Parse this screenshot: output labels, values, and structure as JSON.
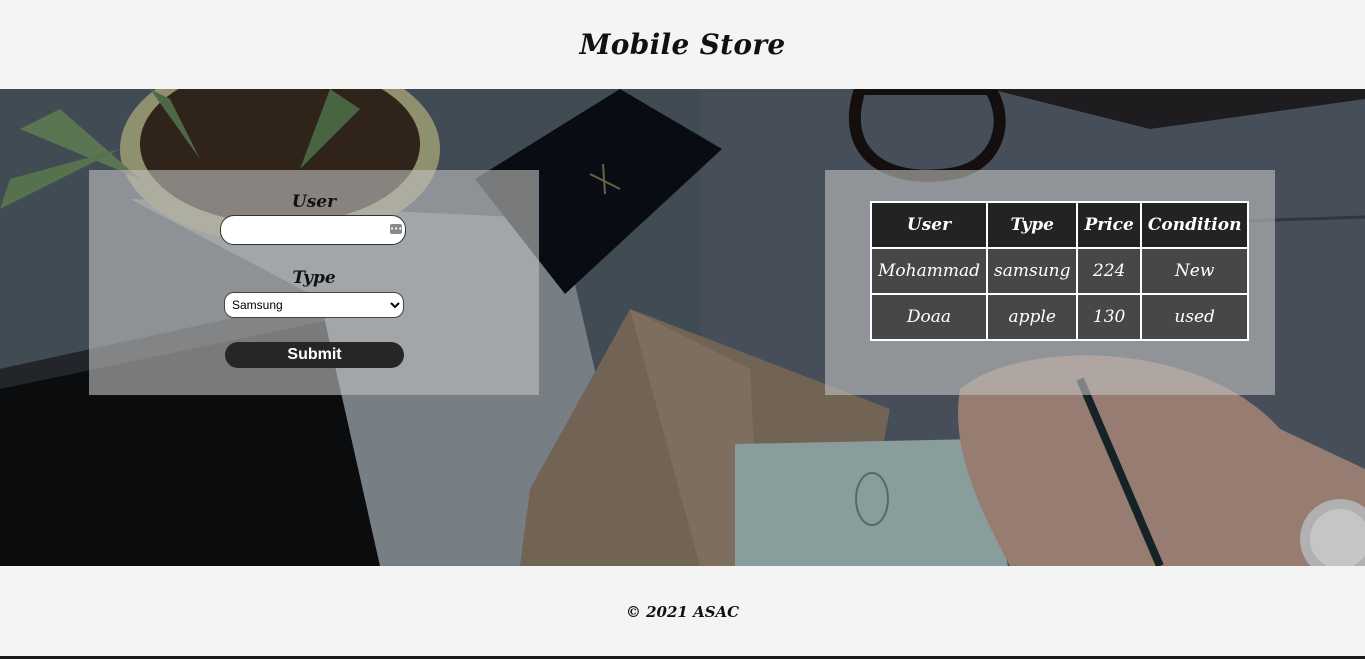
{
  "header": {
    "title": "Mobile Store"
  },
  "form": {
    "user_label": "User",
    "user_value": "",
    "type_label": "Type",
    "type_selected": "Samsung",
    "submit_label": "Submit"
  },
  "table": {
    "headers": [
      "User",
      "Type",
      "Price",
      "Condition"
    ],
    "rows": [
      [
        "Mohammad",
        "samsung",
        "224",
        "New"
      ],
      [
        "Doaa",
        "apple",
        "130",
        "used"
      ]
    ]
  },
  "footer": {
    "copyright": "© 2021 ASAC"
  },
  "colors": {
    "page_bg": "#f4f4f4",
    "panel_overlay": "#bebebe",
    "table_header_bg": "#232323",
    "table_cell_bg": "#474747",
    "button_bg": "#262626"
  }
}
